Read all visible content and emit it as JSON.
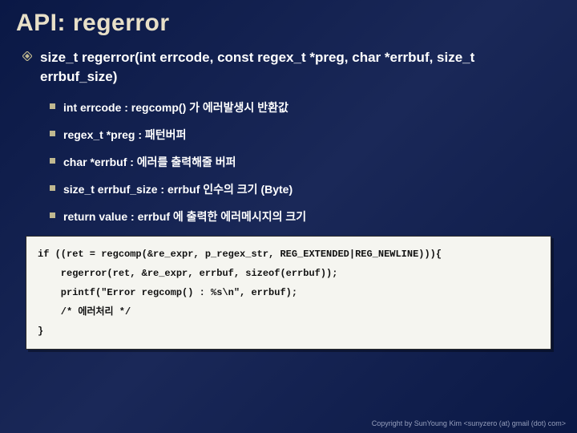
{
  "title": "API: regerror",
  "signature": "size_t regerror(int errcode, const regex_t *preg, char *errbuf, size_t errbuf_size)",
  "params": [
    "int errcode : regcomp() 가 에러발생시 반환값",
    "regex_t *preg : 패턴버퍼",
    "char *errbuf : 에러를 출력해줄 버퍼",
    "size_t errbuf_size : errbuf 인수의 크기 (Byte)",
    "return value : errbuf 에 출력한 에러메시지의 크기"
  ],
  "code": "if ((ret = regcomp(&re_expr, p_regex_str, REG_EXTENDED|REG_NEWLINE))){\n    regerror(ret, &re_expr, errbuf, sizeof(errbuf));\n    printf(\"Error regcomp() : %s\\n\", errbuf);\n    /* 에러처리 */\n}",
  "footer": "Copyright by SunYoung Kim <sunyzero (at) gmail (dot) com>"
}
